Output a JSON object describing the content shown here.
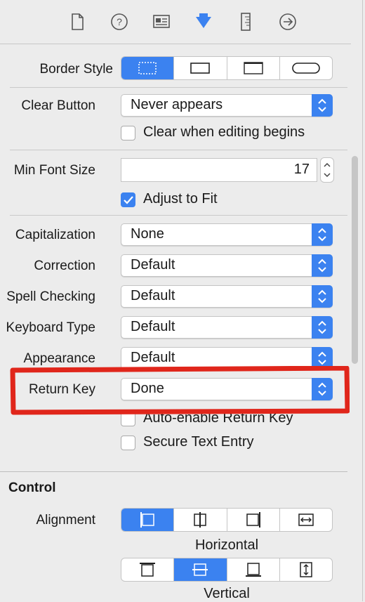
{
  "toolbar": {
    "icons": [
      "file-inspector-icon",
      "quick-help-icon",
      "identity-inspector-icon",
      "attributes-inspector-icon",
      "size-inspector-icon",
      "connections-inspector-icon"
    ],
    "selected": "attributes-inspector-icon"
  },
  "text_field": {
    "border_style": {
      "label": "Border Style",
      "options": [
        "none",
        "line",
        "bezel",
        "rounded"
      ],
      "selected_index": 0
    },
    "clear_button": {
      "label": "Clear Button",
      "value": "Never appears"
    },
    "clear_when_editing": {
      "label": "Clear when editing begins",
      "checked": false
    },
    "min_font_size": {
      "label": "Min Font Size",
      "value": "17"
    },
    "adjust_to_fit": {
      "label": "Adjust to Fit",
      "checked": true
    },
    "capitalization": {
      "label": "Capitalization",
      "value": "None"
    },
    "correction": {
      "label": "Correction",
      "value": "Default"
    },
    "spell_checking": {
      "label": "Spell Checking",
      "value": "Default"
    },
    "keyboard_type": {
      "label": "Keyboard Type",
      "value": "Default"
    },
    "appearance": {
      "label": "Appearance",
      "value": "Default"
    },
    "return_key": {
      "label": "Return Key",
      "value": "Done"
    },
    "auto_enable_return_key": {
      "label": "Auto-enable Return Key",
      "checked": false
    },
    "secure_text_entry": {
      "label": "Secure Text Entry",
      "checked": false
    }
  },
  "control": {
    "section_title": "Control",
    "alignment_label": "Alignment",
    "horizontal_caption": "Horizontal",
    "horizontal_selected_index": 0,
    "vertical_caption": "Vertical",
    "vertical_selected_index": 1
  },
  "colors": {
    "accent": "#3b82f0",
    "highlight_annotation": "#e0261b"
  }
}
